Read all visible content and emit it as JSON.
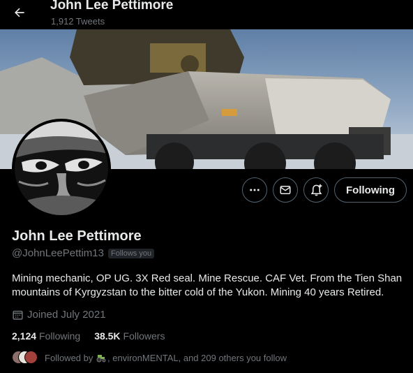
{
  "header": {
    "name": "John Lee Pettimore",
    "tweet_count": "1,912 Tweets"
  },
  "profile": {
    "display_name": "John Lee Pettimore",
    "handle": "@JohnLeePettim13",
    "follows_you": "Follows you",
    "bio": "Mining mechanic, OP UG. 3X Red seal. Mine Rescue. CAF Vet. From the Tien Shan mountains of Kyrgyzstan to the bitter cold of the Yukon. Mining 40 years Retired.",
    "joined": "Joined July 2021"
  },
  "actions": {
    "follow_label": "Following",
    "more_icon": "more-icon",
    "mail_icon": "mail-icon",
    "notify_icon": "notification-add-icon"
  },
  "stats": {
    "following_count": "2,124",
    "following_label": "Following",
    "followers_count": "38.5K",
    "followers_label": "Followers"
  },
  "followed_by": {
    "text_prefix": "Followed by",
    "text_suffix": ", environMENTAL, and 209 others you follow"
  },
  "colors": {
    "background": "#000000",
    "text_primary": "#e7e9ea",
    "text_secondary": "#71767b",
    "border": "#536471"
  }
}
